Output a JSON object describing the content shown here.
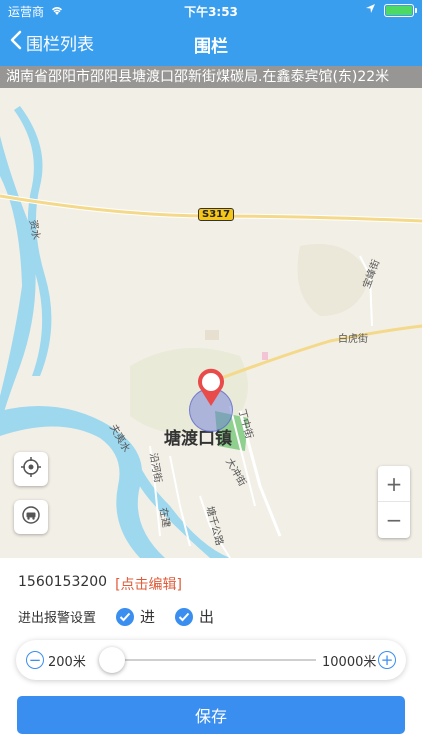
{
  "status_bar": {
    "carrier": "运营商",
    "time": "下午3:53",
    "battery_level": 1.0,
    "accent_color": "#3a9eef"
  },
  "nav": {
    "back_label": "围栏列表",
    "title": "围栏"
  },
  "map": {
    "address": "湖南省邵阳市邵阳县塘渡口邵新街煤碳局.在鑫泰宾馆(东)22米",
    "town_label": "塘渡口镇",
    "road_badge": "S317",
    "street_labels": [
      "白虎街",
      "宝峰街",
      "丁中街",
      "大冲街",
      "沿河街",
      "在建",
      "塘千公路",
      "夫夷水",
      "资水"
    ]
  },
  "panel": {
    "device_id": "1560153200",
    "edit_link": "[点击编辑]",
    "alarm_label": "进出报警设置",
    "option_in": "进",
    "option_out": "出",
    "option_in_checked": true,
    "option_out_checked": true,
    "radius_min_label": "200米",
    "radius_max_label": "10000米",
    "radius_value_fraction": 0.0,
    "save_label": "保存",
    "button_color": "#3a8ef0"
  }
}
